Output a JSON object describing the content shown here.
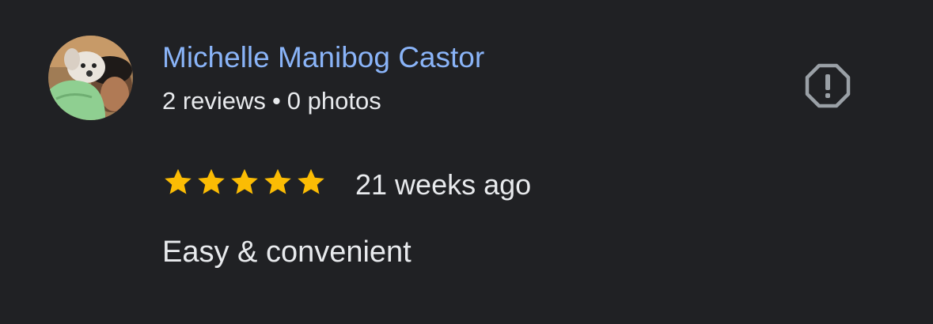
{
  "reviewer": {
    "name": "Michelle Manibog Castor",
    "reviews_count": "2 reviews",
    "separator": "•",
    "photos_count": "0 photos",
    "avatar_icon": "profile-photo"
  },
  "review": {
    "rating": 5,
    "max_rating": 5,
    "time_ago": "21 weeks ago",
    "text": "Easy & convenient"
  },
  "actions": {
    "report_icon": "report-flag-icon"
  },
  "colors": {
    "background": "#202124",
    "name": "#8ab4f8",
    "text": "#e8eaed",
    "star": "#fbbc04",
    "icon": "#9aa0a6"
  }
}
